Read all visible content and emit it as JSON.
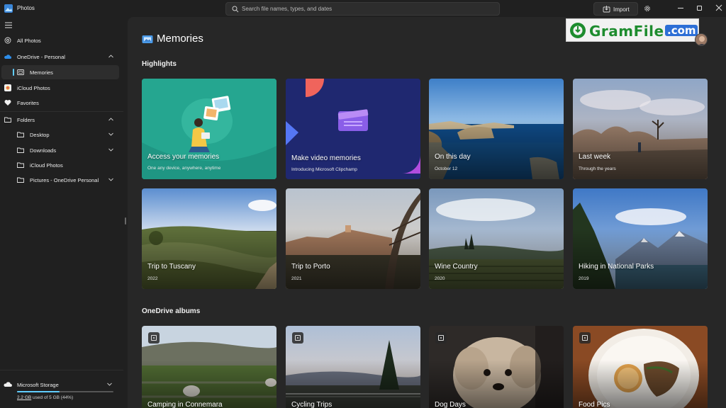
{
  "app": {
    "title": "Photos"
  },
  "search": {
    "placeholder": "Search file names, types, and dates"
  },
  "toolbar": {
    "import_label": "Import"
  },
  "sidebar": {
    "items": [
      {
        "label": "All Photos"
      },
      {
        "label": "OneDrive - Personal"
      },
      {
        "label": "Memories"
      },
      {
        "label": "iCloud Photos"
      },
      {
        "label": "Favorites"
      },
      {
        "label": "Folders"
      },
      {
        "label": "Desktop"
      },
      {
        "label": "Downloads"
      },
      {
        "label": "iCloud Photos"
      },
      {
        "label": "Pictures - OneDrive Personal"
      }
    ],
    "storage": {
      "title": "Microsoft Storage",
      "used": "2.2 GB",
      "rest": " used of 5 GB (44%)",
      "fraction": 0.44
    }
  },
  "main": {
    "title": "Memories",
    "highlights_title": "Highlights",
    "albums_title": "OneDrive albums",
    "highlights": [
      {
        "title": "Access your memories",
        "subtitle": "One any device, anywhere, anytime"
      },
      {
        "title": "Make video memories",
        "subtitle": "Introducing Microsoft Clipchamp"
      },
      {
        "title": "On this day",
        "subtitle": "October 12"
      },
      {
        "title": "Last week",
        "subtitle": "Through the years"
      },
      {
        "title": "Trip to Tuscany",
        "subtitle": "2022"
      },
      {
        "title": "Trip to Porto",
        "subtitle": "2021"
      },
      {
        "title": "Wine Country",
        "subtitle": "2020"
      },
      {
        "title": "Hiking in National Parks",
        "subtitle": "2019"
      }
    ],
    "albums": [
      {
        "title": "Camping in Connemara"
      },
      {
        "title": "Cycling Trips"
      },
      {
        "title": "Dog Days"
      },
      {
        "title": "Food Pics"
      }
    ]
  },
  "watermark": {
    "brand": "GramFile",
    "domain": ".com"
  },
  "colors": {
    "accent": "#60cdff",
    "background": "#202020",
    "content": "#272727",
    "watermark_green": "#1d8c2e",
    "watermark_blue": "#2d6fd6"
  }
}
